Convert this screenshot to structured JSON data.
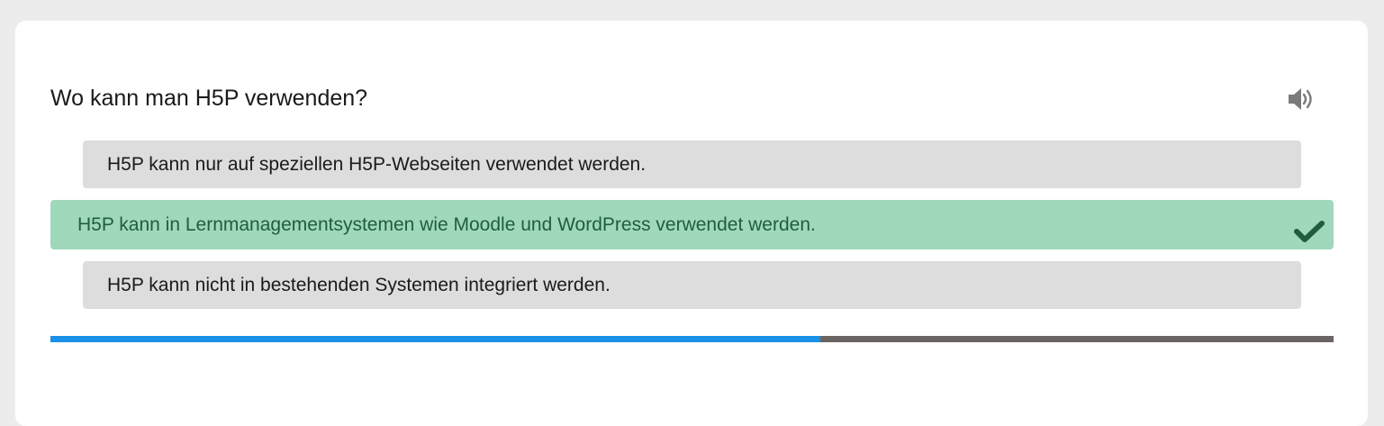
{
  "question": {
    "text": "Wo kann man H5P verwenden?",
    "audio_icon": "speaker-icon"
  },
  "answers": [
    {
      "label": "H5P kann nur auf speziellen H5P-Webseiten verwendet werden.",
      "state": "neutral"
    },
    {
      "label": "H5P kann in Lernmanagementsystemen wie Moodle und WordPress verwendet werden.",
      "state": "correct",
      "icon": "checkmark-icon"
    },
    {
      "label": "H5P kann nicht in bestehenden Systemen integriert werden.",
      "state": "neutral"
    }
  ],
  "progress": {
    "fraction": 0.6
  },
  "colors": {
    "page_background": "#ececec",
    "card": "#ffffff",
    "answer_neutral": "#dddddd",
    "answer_correct": "#a0d8bc",
    "answer_correct_text": "#1e5e3e",
    "progress_fill": "#1a90e6",
    "progress_track": "#6a6462"
  }
}
